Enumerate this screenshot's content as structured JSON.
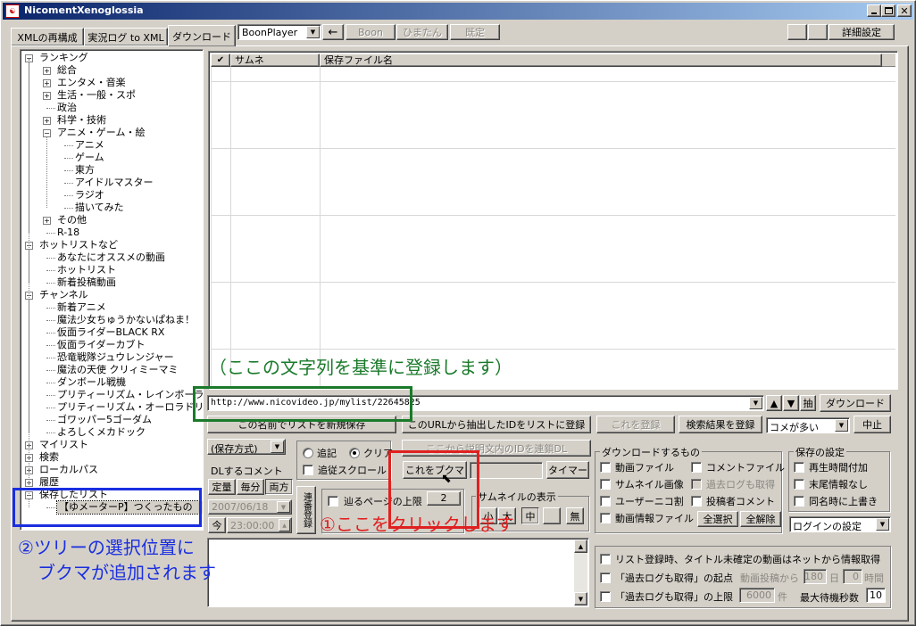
{
  "window": {
    "title": "NicomentXenoglossia",
    "app_icon": "app-icon"
  },
  "tabs": [
    "XMLの再構成",
    "実況ログ to XML",
    "ダウンロード"
  ],
  "toolbar": {
    "player_select": "BoonPlayer",
    "back_arrow": "←",
    "btn_boon": "Boon",
    "btn_himan": "ひまたん",
    "btn_default": "既定",
    "btn_details": "詳細設定"
  },
  "tree": [
    {
      "label": "ランキング",
      "depth": 0,
      "pm": "-"
    },
    {
      "label": "総合",
      "depth": 1,
      "pm": "+"
    },
    {
      "label": "エンタメ・音楽",
      "depth": 1,
      "pm": "+"
    },
    {
      "label": "生活・一般・スポ",
      "depth": 1,
      "pm": "+"
    },
    {
      "label": "政治",
      "depth": 1,
      "pm": ""
    },
    {
      "label": "科学・技術",
      "depth": 1,
      "pm": "+"
    },
    {
      "label": "アニメ・ゲーム・絵",
      "depth": 1,
      "pm": "-"
    },
    {
      "label": "アニメ",
      "depth": 2,
      "pm": ""
    },
    {
      "label": "ゲーム",
      "depth": 2,
      "pm": ""
    },
    {
      "label": "東方",
      "depth": 2,
      "pm": ""
    },
    {
      "label": "アイドルマスター",
      "depth": 2,
      "pm": ""
    },
    {
      "label": "ラジオ",
      "depth": 2,
      "pm": ""
    },
    {
      "label": "描いてみた",
      "depth": 2,
      "pm": ""
    },
    {
      "label": "その他",
      "depth": 1,
      "pm": "+"
    },
    {
      "label": "R-18",
      "depth": 1,
      "pm": ""
    },
    {
      "label": "ホットリストなど",
      "depth": 0,
      "pm": "-"
    },
    {
      "label": "あなたにオススメの動画",
      "depth": 1,
      "pm": ""
    },
    {
      "label": "ホットリスト",
      "depth": 1,
      "pm": ""
    },
    {
      "label": "新着投稿動画",
      "depth": 1,
      "pm": ""
    },
    {
      "label": "チャンネル",
      "depth": 0,
      "pm": "-"
    },
    {
      "label": "新着アニメ",
      "depth": 1,
      "pm": ""
    },
    {
      "label": "魔法少女ちゅうかないぱねま！",
      "depth": 1,
      "pm": ""
    },
    {
      "label": "仮面ライダーBLACK RX",
      "depth": 1,
      "pm": ""
    },
    {
      "label": "仮面ライダーカブト",
      "depth": 1,
      "pm": ""
    },
    {
      "label": "恐竜戦隊ジュウレンジャー",
      "depth": 1,
      "pm": ""
    },
    {
      "label": "魔法の天使 クリィミーマミ",
      "depth": 1,
      "pm": ""
    },
    {
      "label": "ダンボール戦機",
      "depth": 1,
      "pm": ""
    },
    {
      "label": "プリティーリズム・レインボーライブ",
      "depth": 1,
      "pm": ""
    },
    {
      "label": "プリティーリズム・オーロラドリーム",
      "depth": 1,
      "pm": ""
    },
    {
      "label": "ゴワッパー5ゴーダム",
      "depth": 1,
      "pm": ""
    },
    {
      "label": "よろしくメカドック",
      "depth": 1,
      "pm": ""
    },
    {
      "label": "マイリスト",
      "depth": 0,
      "pm": "+"
    },
    {
      "label": "検索",
      "depth": 0,
      "pm": "+"
    },
    {
      "label": "ローカルパス",
      "depth": 0,
      "pm": "+"
    },
    {
      "label": "履歴",
      "depth": 0,
      "pm": "+"
    },
    {
      "label": "保存したリスト",
      "depth": 0,
      "pm": "-"
    },
    {
      "label": "【ゆメーターP】つくったもの【アイマス】",
      "depth": 1,
      "pm": "",
      "selected": true
    }
  ],
  "list": {
    "check_header": "✔",
    "col_thumb": "サムネ",
    "col_file": "保存ファイル名"
  },
  "url_bar": {
    "value": "http://www.nicovideo.jp/mylist/22645825",
    "up": "▲",
    "down": "▼",
    "extract": "抽",
    "download": "ダウンロード"
  },
  "row1": {
    "new_list_btn": "この名前でリストを新規保存",
    "register_ids": "このURLから抽出したIDをリストに登録",
    "register_this": "これを登録",
    "register_results": "検索結果を登録",
    "comment_select": "コメが多い",
    "stop": "中止"
  },
  "left_controls": {
    "save_mode": "(保存方式)",
    "dl_comment_label": "DLするコメント",
    "fixed_btn": "定量",
    "each_btn": "毎分",
    "both_btn": "両方",
    "date": "2007/06/18",
    "today_btn": "今",
    "time": "23:00:00",
    "renban_btn": "連番登録"
  },
  "mid_controls": {
    "append_label": "追記",
    "clear_label": "クリア",
    "follow_scroll": "追従スクロール",
    "link_dl": "ここから説明文内のIDを連鎖DL",
    "bookmark_btn": "これをブクマ",
    "timer_btn": "タイマー",
    "follow_pages": "辿るページの上限",
    "pages_count": "2",
    "thumb_label": "サムネイルの表示",
    "thumb_small": "小",
    "thumb_large": "大",
    "thumb_mid": "中",
    "thumb_none": "無"
  },
  "dl_group": {
    "title": "ダウンロードするもの",
    "video": "動画ファイル",
    "comment_file": "コメントファイル",
    "thumb_img": "サムネイル画像",
    "past_log": "過去ログも取得",
    "user_niko": "ユーザーニコ割",
    "poster_comment": "投稿者コメント",
    "video_info": "動画情報ファイル",
    "select_all": "全選択",
    "deselect_all": "全解除"
  },
  "save_group": {
    "title": "保存の設定",
    "play_time": "再生時間付加",
    "no_tail": "末尾情報なし",
    "overwrite": "同名時に上書き",
    "login_select": "ログインの設定"
  },
  "bottom": {
    "fetch_info": "リスト登録時、タイトル未確定の動画はネットから情報取得",
    "past_start": "「過去ログも取得」の起点",
    "from_post": "動画投稿から",
    "days_val": "180",
    "days_unit": "日",
    "hours_val": "0",
    "hours_unit": "時間",
    "past_limit": "「過去ログも取得」の上限",
    "count_val": "6000",
    "count_unit": "件",
    "max_wait": "最大待機秒数",
    "wait_val": "10"
  },
  "annotations": {
    "green_note": "（ここの文字列を基準に登録します）",
    "red_note": "①ここをクリックします",
    "blue_note_line1": "②ツリーの選択位置に",
    "blue_note_line2": "ブクマが追加されます"
  },
  "colors": {
    "title_bar": "#0a246a",
    "title_bar_end": "#a6caf0",
    "green": "#1a7a2a",
    "red": "#e02020",
    "blue": "#1a2ee0",
    "selection": "#0a246a"
  }
}
